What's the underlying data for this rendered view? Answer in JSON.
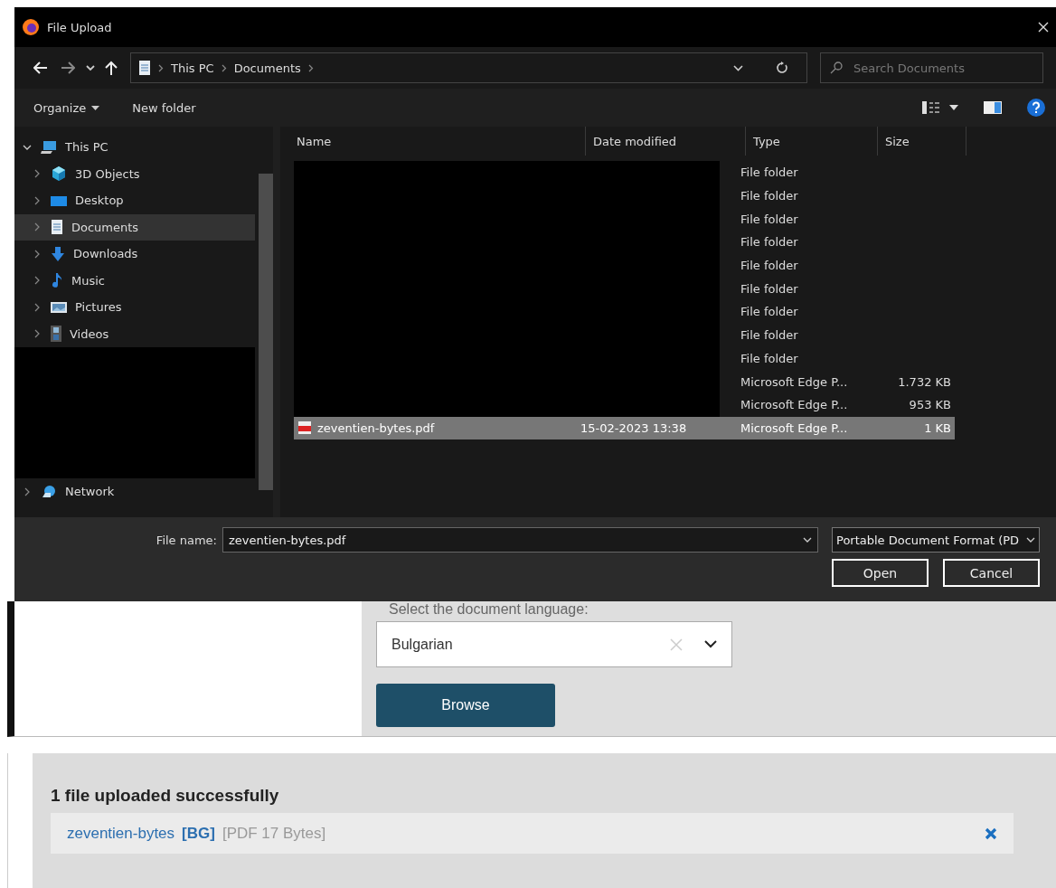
{
  "window": {
    "title": "File Upload"
  },
  "address_bar": {
    "breadcrumb": [
      "This PC",
      "Documents"
    ],
    "search_placeholder": "Search Documents"
  },
  "toolbar": [
    "Organize",
    "New folder"
  ],
  "nav_pane": [
    {
      "label": "This PC",
      "expanded": true,
      "selected": false,
      "children": [
        {
          "label": "3D Objects",
          "selected": false
        },
        {
          "label": "Desktop",
          "selected": false
        },
        {
          "label": "Documents",
          "selected": true
        },
        {
          "label": "Downloads",
          "selected": false
        },
        {
          "label": "Music",
          "selected": false
        },
        {
          "label": "Pictures",
          "selected": false
        },
        {
          "label": "Videos",
          "selected": false
        }
      ]
    },
    {
      "label": "Network",
      "expanded": false,
      "selected": false
    }
  ],
  "file_list": {
    "columns": [
      "Name",
      "Date modified",
      "Type",
      "Size"
    ],
    "rows": [
      {
        "type": "File folder",
        "selected": false
      },
      {
        "type": "File folder",
        "selected": false
      },
      {
        "type": "File folder",
        "selected": false
      },
      {
        "type": "File folder",
        "selected": false
      },
      {
        "type": "File folder",
        "selected": false
      },
      {
        "type": "File folder",
        "selected": false
      },
      {
        "type": "File folder",
        "selected": false
      },
      {
        "type": "File folder",
        "selected": false
      },
      {
        "type": "File folder",
        "selected": false
      },
      {
        "type": "Microsoft Edge P...",
        "size": "1.732 KB",
        "selected": false
      },
      {
        "type": "Microsoft Edge P...",
        "size": "953 KB",
        "selected": false
      },
      {
        "name": "zeventien-bytes.pdf",
        "date": "15-02-2023 13:38",
        "type": "Microsoft Edge P...",
        "size": "1 KB",
        "selected": true
      }
    ]
  },
  "footer": {
    "file_name_label": "File name:",
    "file_name": "zeventien-bytes.pdf",
    "file_type": "Portable Document Format (PD",
    "buttons": [
      "Open",
      "Cancel"
    ]
  },
  "web_page": {
    "language_label": "Select the document language:",
    "language": "Bulgarian",
    "browse_button": "Browse",
    "upload_heading": "1 file uploaded successfully",
    "uploaded_files": [
      {
        "name": "zeventien-bytes",
        "language": "[BG]",
        "info": "[PDF 17 Bytes]"
      }
    ]
  }
}
